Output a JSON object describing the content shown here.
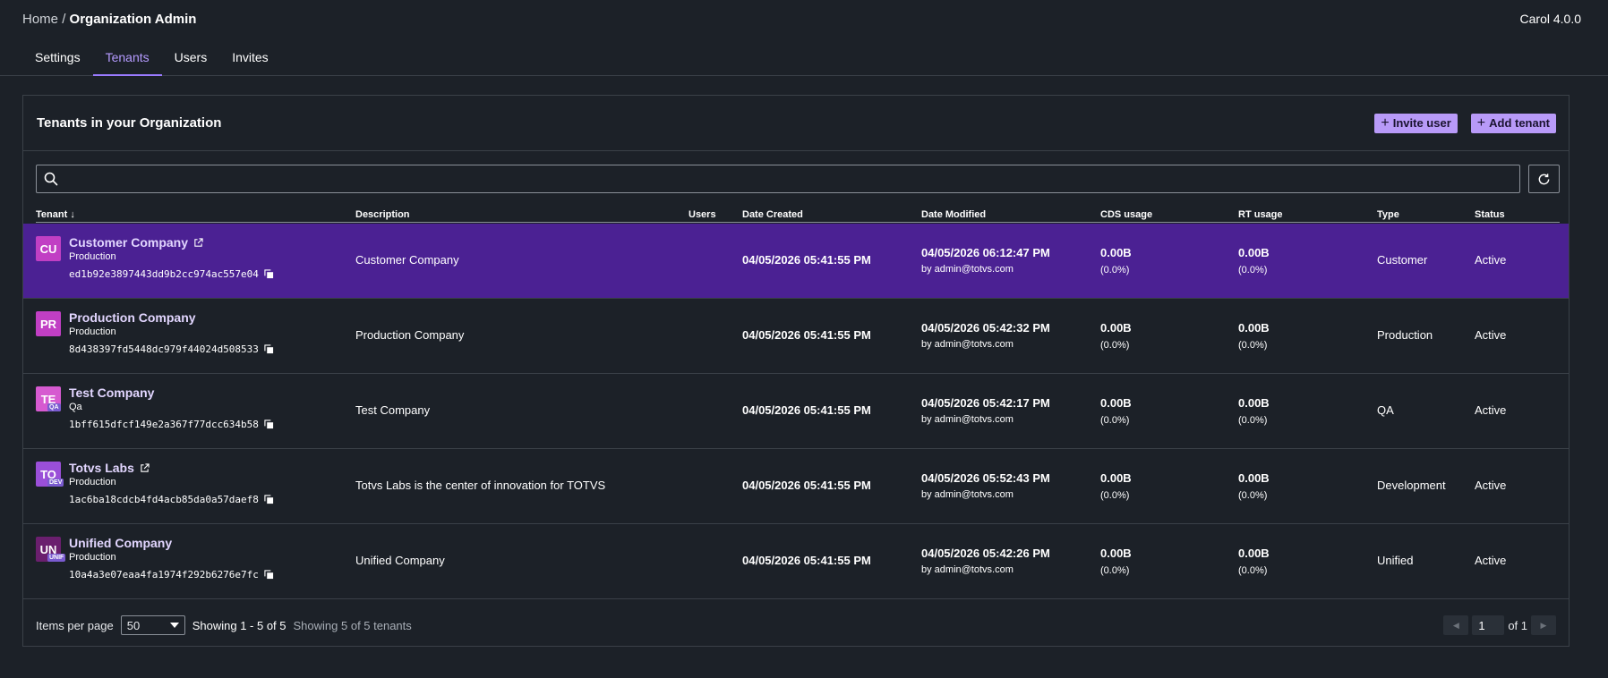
{
  "breadcrumb": {
    "home": "Home",
    "separator": "/",
    "current": "Organization Admin"
  },
  "version": "Carol 4.0.0",
  "tabs": [
    {
      "label": "Settings"
    },
    {
      "label": "Tenants"
    },
    {
      "label": "Users"
    },
    {
      "label": "Invites"
    }
  ],
  "panel": {
    "title": "Tenants in your Organization",
    "invite_label": "Invite user",
    "add_label": "Add tenant"
  },
  "search": {
    "value": "",
    "placeholder": ""
  },
  "columns": {
    "tenant": "Tenant",
    "sort_indicator": "↓",
    "description": "Description",
    "users": "Users",
    "date_created": "Date Created",
    "date_modified": "Date Modified",
    "cds": "CDS usage",
    "rt": "RT usage",
    "type": "Type",
    "status": "Status"
  },
  "tenants": [
    {
      "initials": "CU",
      "badge": "",
      "name": "Customer Company",
      "env": "Production",
      "id": "ed1b92e3897443dd9b2cc974ac557e04",
      "description": "Customer Company",
      "users": "",
      "created": "04/05/2026 05:41:55 PM",
      "modified": "04/05/2026 06:12:47 PM",
      "modified_by": "by admin@totvs.com",
      "cds": "0.00B",
      "cds_pct": "(0.0%)",
      "rt": "0.00B",
      "rt_pct": "(0.0%)",
      "type": "Customer",
      "status": "Active",
      "avatar_color": "#c13fc4"
    },
    {
      "initials": "PR",
      "badge": "",
      "name": "Production Company",
      "env": "Production",
      "id": "8d438397fd5448dc979f44024d508533",
      "description": "Production Company",
      "users": "",
      "created": "04/05/2026 05:41:55 PM",
      "modified": "04/05/2026 05:42:32 PM",
      "modified_by": "by admin@totvs.com",
      "cds": "0.00B",
      "cds_pct": "(0.0%)",
      "rt": "0.00B",
      "rt_pct": "(0.0%)",
      "type": "Production",
      "status": "Active",
      "avatar_color": "#c13fc4"
    },
    {
      "initials": "TE",
      "badge": "QA",
      "name": "Test Company",
      "env": "Qa",
      "id": "1bff615dfcf149e2a367f77dcc634b58",
      "description": "Test Company",
      "users": "",
      "created": "04/05/2026 05:41:55 PM",
      "modified": "04/05/2026 05:42:17 PM",
      "modified_by": "by admin@totvs.com",
      "cds": "0.00B",
      "cds_pct": "(0.0%)",
      "rt": "0.00B",
      "rt_pct": "(0.0%)",
      "type": "QA",
      "status": "Active",
      "avatar_color": "#d65ad0"
    },
    {
      "initials": "TO",
      "badge": "DEV",
      "name": "Totvs Labs",
      "env": "Production",
      "id": "1ac6ba18cdcb4fd4acb85da0a57daef8",
      "description": "Totvs Labs is the center of innovation for TOTVS",
      "users": "",
      "created": "04/05/2026 05:41:55 PM",
      "modified": "04/05/2026 05:52:43 PM",
      "modified_by": "by admin@totvs.com",
      "cds": "0.00B",
      "cds_pct": "(0.0%)",
      "rt": "0.00B",
      "rt_pct": "(0.0%)",
      "type": "Development",
      "status": "Active",
      "avatar_color": "#9a4fd8"
    },
    {
      "initials": "UN",
      "badge": "UNIF",
      "name": "Unified Company",
      "env": "Production",
      "id": "10a4a3e07eaa4fa1974f292b6276e7fc",
      "description": "Unified Company",
      "users": "",
      "created": "04/05/2026 05:41:55 PM",
      "modified": "04/05/2026 05:42:26 PM",
      "modified_by": "by admin@totvs.com",
      "cds": "0.00B",
      "cds_pct": "(0.0%)",
      "rt": "0.00B",
      "rt_pct": "(0.0%)",
      "type": "Unified",
      "status": "Active",
      "avatar_color": "#6a1f6e"
    }
  ],
  "footer": {
    "items_per_page_label": "Items per page",
    "items_per_page_value": "50",
    "showing_range": "Showing 1 - 5 of 5",
    "showing_count": "Showing 5 of 5 tenants",
    "page_value": "1",
    "page_of": "of 1"
  },
  "colors": {
    "accent": "#b89af8",
    "selected_row": "#4b2193",
    "background": "#1c2128"
  }
}
